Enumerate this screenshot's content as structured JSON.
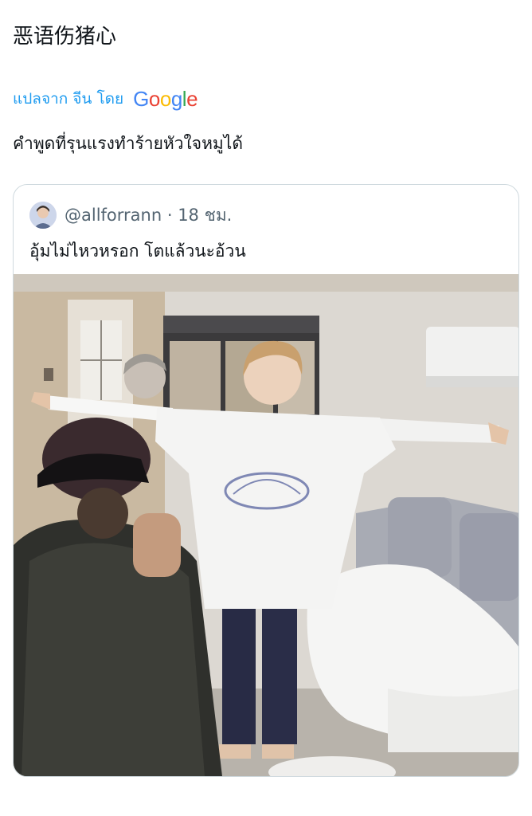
{
  "tweet": {
    "text": "恶语伤猪心"
  },
  "translation": {
    "label": "แปลจาก จีน โดย",
    "provider_icon": "google-logo",
    "provider_letters": [
      {
        "char": "G",
        "color": "#4285F4"
      },
      {
        "char": "o",
        "color": "#EA4335"
      },
      {
        "char": "o",
        "color": "#FBBC05"
      },
      {
        "char": "g",
        "color": "#4285F4"
      },
      {
        "char": "l",
        "color": "#34A853"
      },
      {
        "char": "e",
        "color": "#EA4335"
      }
    ],
    "text": "คำพูดที่รุนแรงทำร้ายหัวใจหมูได้"
  },
  "quote": {
    "handle_time": "@allforrann · 18 ชม.",
    "text": "อุ้มไม่ไหวหรอก โตแล้วนะอ้วน",
    "avatar_icon": "user-avatar",
    "photo_icon": "room-photo"
  },
  "colors": {
    "link": "#1d9bf0",
    "secondary_text": "#536471",
    "border": "#cfd9de"
  }
}
